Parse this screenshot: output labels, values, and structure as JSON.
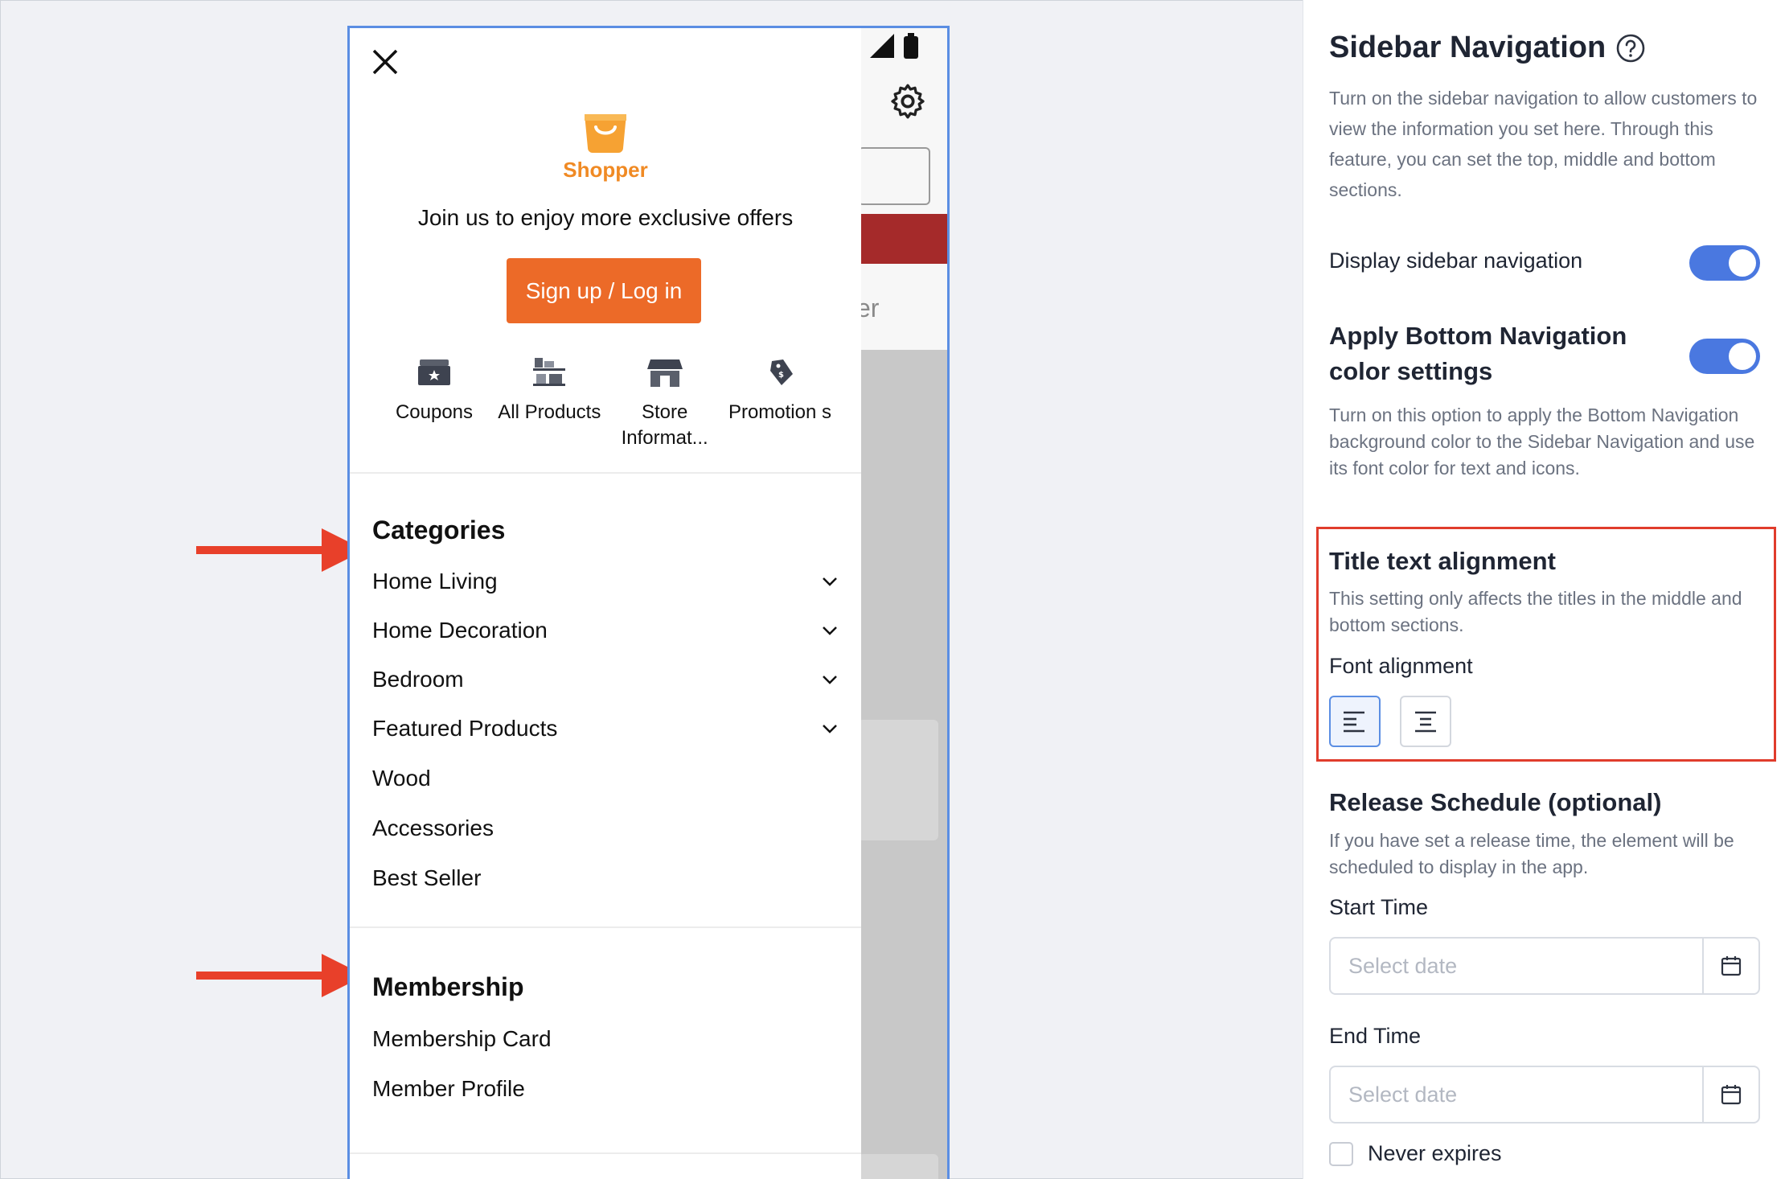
{
  "preview": {
    "brand": "Shopper",
    "tagline": "Join us to enjoy more exclusive offers",
    "sign_in_label": "Sign up / Log in",
    "background_partial_text": "er",
    "quick_links": [
      {
        "icon": "coupon-icon",
        "label": "Coupons"
      },
      {
        "icon": "shelf-icon",
        "label": "All Products"
      },
      {
        "icon": "store-icon",
        "label": "Store Informat..."
      },
      {
        "icon": "tag-icon",
        "label": "Promotion s"
      }
    ],
    "categories": {
      "title": "Categories",
      "items": [
        {
          "label": "Home Living",
          "expandable": true
        },
        {
          "label": "Home Decoration",
          "expandable": true
        },
        {
          "label": "Bedroom",
          "expandable": true
        },
        {
          "label": "Featured Products",
          "expandable": true
        },
        {
          "label": "Wood",
          "expandable": false
        },
        {
          "label": "Accessories",
          "expandable": false
        },
        {
          "label": "Best Seller",
          "expandable": false
        }
      ]
    },
    "membership": {
      "title": "Membership",
      "items": [
        {
          "label": "Membership Card"
        },
        {
          "label": "Member Profile"
        }
      ]
    }
  },
  "settings": {
    "title": "Sidebar Navigation",
    "description": "Turn on the sidebar navigation to allow customers to view the information you set here. Through this feature, you can set the top, middle and bottom sections.",
    "display_toggle_label": "Display sidebar navigation",
    "display_toggle_on": true,
    "bottom_nav_title": "Apply Bottom Navigation color settings",
    "bottom_nav_on": true,
    "bottom_nav_description": "Turn on this option to apply the Bottom Navigation background color to the Sidebar Navigation and use its font color for text and icons.",
    "alignment_title": "Title text alignment",
    "alignment_description": "This setting only affects the titles in the middle and bottom sections.",
    "font_alignment_label": "Font alignment",
    "alignment_selected": "left",
    "release_title": "Release Schedule (optional)",
    "release_description": "If you have set a release time, the element will be scheduled to display in the app.",
    "start_label": "Start Time",
    "start_placeholder": "Select date",
    "end_label": "End Time",
    "end_placeholder": "Select date",
    "never_expires_label": "Never expires",
    "never_expires_checked": false
  },
  "colors": {
    "accent": "#4a78e0",
    "brand_orange": "#ec6a28",
    "highlight_red": "#e03c2c"
  }
}
